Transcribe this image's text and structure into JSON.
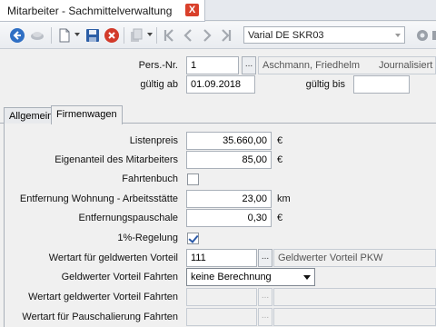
{
  "document_tab": {
    "title": "Mitarbeiter - Sachmittelverwaltung",
    "close_label": "X"
  },
  "toolbar": {
    "icons": [
      "back-icon",
      "refresh-icon",
      "new-document-icon",
      "save-icon",
      "delete-icon",
      "copy-icon",
      "first-record-icon",
      "prev-record-icon",
      "next-record-icon",
      "last-record-icon",
      "settings-icon",
      "tools-icon"
    ],
    "variant_combo": "Varial  DE SKR03"
  },
  "header": {
    "pers_nr_label": "Pers.-Nr.",
    "pers_nr_value": "1",
    "employee_name": "Aschmann, Friedhelm",
    "employee_status": "Journalisiert b",
    "valid_from_label": "gültig ab",
    "valid_from_value": "01.09.2018",
    "valid_to_label": "gültig bis",
    "valid_to_value": "",
    "lookup_label": "..."
  },
  "tabs": [
    {
      "label": "Allgemein",
      "active": false
    },
    {
      "label": "Firmenwagen",
      "active": true
    }
  ],
  "form": {
    "listenpreis_label": "Listenpreis",
    "listenpreis_value": "35.660,00",
    "listenpreis_unit": "€",
    "eigenanteil_label": "Eigenanteil des Mitarbeiters",
    "eigenanteil_value": "85,00",
    "eigenanteil_unit": "€",
    "fahrtenbuch_label": "Fahrtenbuch",
    "fahrtenbuch_checked": false,
    "entfernung_label": "Entfernung Wohnung - Arbeitsstätte",
    "entfernung_value": "23,00",
    "entfernung_unit": "km",
    "pauschale_label": "Entfernungspauschale",
    "pauschale_value": "0,30",
    "pauschale_unit": "€",
    "regelung_label": "1%-Regelung",
    "regelung_checked": true,
    "wertart_gv_label": "Wertart für geldwerten Vorteil",
    "wertart_gv_value": "111",
    "wertart_gv_desc": "Geldwerter Vorteil PKW",
    "gv_fahrten_label": "Geldwerter Vorteil Fahrten",
    "gv_fahrten_value": "keine Berechnung",
    "wertart_gv_fahrten_label": "Wertart geldwerter Vorteil Fahrten",
    "wertart_gv_fahrten_value": "",
    "wertart_pausch_label": "Wertart für Pauschalierung Fahrten",
    "wertart_pausch_value": ""
  },
  "colors": {
    "close_red": "#d9402b",
    "checkmark_blue": "#2b5aa8"
  }
}
